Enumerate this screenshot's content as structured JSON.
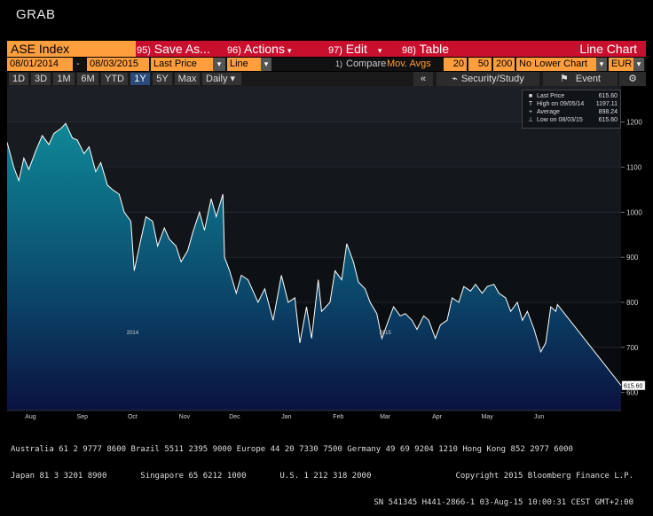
{
  "window": {
    "title": "GRAB"
  },
  "toolbar": {
    "ticker": "ASE Index",
    "menus": [
      {
        "num": "95)",
        "label": "Save As...",
        "arrow": ""
      },
      {
        "num": "96)",
        "label": "Actions",
        "arrow": "▾"
      },
      {
        "num": "97)",
        "label": "Edit",
        "arrow": "▾"
      },
      {
        "num": "98)",
        "label": "Table",
        "arrow": ""
      }
    ],
    "chart_type_title": "Line Chart"
  },
  "controls": {
    "start_date": "08/01/2014",
    "dash": "-",
    "end_date": "08/03/2015",
    "field": "Last Price",
    "style": "Line",
    "compare_num": "1)",
    "compare_label": "Compare",
    "compare_value": "Mov. Avgs",
    "ma1": "20",
    "ma2": "50",
    "ma3": "200",
    "lower_chart": "No Lower Chart",
    "currency": "EUR",
    "dd_arrow": "▾"
  },
  "timeframes": [
    "1D",
    "3D",
    "1M",
    "6M",
    "YTD",
    "1Y",
    "5Y",
    "Max"
  ],
  "selected_timeframe": "1Y",
  "periodicity": "Daily",
  "tools": {
    "collapse": "«",
    "security_study": "Security/Study",
    "event": "Event"
  },
  "legend": {
    "items": [
      {
        "mark": "■",
        "label": "Last Price",
        "value": "615.60"
      },
      {
        "mark": "T",
        "label": "High on 09/05/14",
        "value": "1197.11"
      },
      {
        "mark": "+",
        "label": "Average",
        "value": "898.24"
      },
      {
        "mark": "⊥",
        "label": "Low on 08/03/15",
        "value": "615.60"
      }
    ]
  },
  "footer": {
    "line1": "Australia 61 2 9777 8600 Brazil 5511 2395 9000 Europe 44 20 7330 7500 Germany 49 69 9204 1210 Hong Kong 852 2977 6000",
    "line2a": "Japan 81 3 3201 8900       Singapore 65 6212 1000       U.S. 1 212 318 2000",
    "line2b": "Copyright 2015 Bloomberg Finance L.P.",
    "line3": "SN 541345 H441-2866-1 03-Aug-15 10:00:31 CEST GMT+2:00"
  },
  "colors": {
    "accent_red": "#c8102e",
    "accent_orange": "#ff9e3d",
    "line": "#ffffff",
    "fill_top": "#0e7f8f",
    "fill_bottom": "#0b1240"
  },
  "chart_data": {
    "type": "area",
    "title": "",
    "xlabel": "",
    "ylabel": "",
    "ylim": [
      560,
      1280
    ],
    "yticks": [
      600,
      700,
      800,
      900,
      1000,
      1100,
      1200
    ],
    "xlim": [
      "2014-08-01",
      "2015-08-03"
    ],
    "month_ticks": [
      {
        "date": "2014-08-15",
        "label": "Aug",
        "year": ""
      },
      {
        "date": "2014-09-15",
        "label": "Sep",
        "year": ""
      },
      {
        "date": "2014-10-15",
        "label": "Oct",
        "year": "2014"
      },
      {
        "date": "2014-11-15",
        "label": "Nov",
        "year": ""
      },
      {
        "date": "2014-12-15",
        "label": "Dec",
        "year": ""
      },
      {
        "date": "2015-01-15",
        "label": "Jan",
        "year": ""
      },
      {
        "date": "2015-02-15",
        "label": "Feb",
        "year": ""
      },
      {
        "date": "2015-03-15",
        "label": "Mar",
        "year": "2015"
      },
      {
        "date": "2015-04-15",
        "label": "Apr",
        "year": ""
      },
      {
        "date": "2015-05-15",
        "label": "May",
        "year": ""
      },
      {
        "date": "2015-06-15",
        "label": "Jun",
        "year": ""
      }
    ],
    "last_label": "615.60",
    "series": [
      {
        "name": "Last Price",
        "points": [
          [
            "2014-08-01",
            1155
          ],
          [
            "2014-08-05",
            1100
          ],
          [
            "2014-08-08",
            1070
          ],
          [
            "2014-08-11",
            1120
          ],
          [
            "2014-08-14",
            1095
          ],
          [
            "2014-08-18",
            1135
          ],
          [
            "2014-08-22",
            1170
          ],
          [
            "2014-08-26",
            1150
          ],
          [
            "2014-08-29",
            1175
          ],
          [
            "2014-09-02",
            1185
          ],
          [
            "2014-09-05",
            1197
          ],
          [
            "2014-09-09",
            1165
          ],
          [
            "2014-09-12",
            1160
          ],
          [
            "2014-09-16",
            1130
          ],
          [
            "2014-09-19",
            1145
          ],
          [
            "2014-09-23",
            1090
          ],
          [
            "2014-09-26",
            1110
          ],
          [
            "2014-09-30",
            1060
          ],
          [
            "2014-10-03",
            1050
          ],
          [
            "2014-10-07",
            1040
          ],
          [
            "2014-10-10",
            1000
          ],
          [
            "2014-10-14",
            980
          ],
          [
            "2014-10-16",
            870
          ],
          [
            "2014-10-20",
            940
          ],
          [
            "2014-10-23",
            990
          ],
          [
            "2014-10-27",
            980
          ],
          [
            "2014-10-30",
            925
          ],
          [
            "2014-11-03",
            965
          ],
          [
            "2014-11-06",
            940
          ],
          [
            "2014-11-10",
            925
          ],
          [
            "2014-11-13",
            890
          ],
          [
            "2014-11-17",
            915
          ],
          [
            "2014-11-20",
            955
          ],
          [
            "2014-11-24",
            1000
          ],
          [
            "2014-11-27",
            960
          ],
          [
            "2014-12-01",
            1030
          ],
          [
            "2014-12-04",
            990
          ],
          [
            "2014-12-08",
            1040
          ],
          [
            "2014-12-09",
            900
          ],
          [
            "2014-12-12",
            870
          ],
          [
            "2014-12-16",
            820
          ],
          [
            "2014-12-19",
            860
          ],
          [
            "2014-12-23",
            850
          ],
          [
            "2014-12-29",
            800
          ],
          [
            "2015-01-02",
            830
          ],
          [
            "2015-01-07",
            760
          ],
          [
            "2015-01-12",
            860
          ],
          [
            "2015-01-16",
            800
          ],
          [
            "2015-01-20",
            810
          ],
          [
            "2015-01-23",
            710
          ],
          [
            "2015-01-27",
            790
          ],
          [
            "2015-01-30",
            720
          ],
          [
            "2015-02-03",
            850
          ],
          [
            "2015-02-05",
            780
          ],
          [
            "2015-02-10",
            800
          ],
          [
            "2015-02-13",
            870
          ],
          [
            "2015-02-17",
            850
          ],
          [
            "2015-02-20",
            930
          ],
          [
            "2015-02-24",
            890
          ],
          [
            "2015-02-27",
            845
          ],
          [
            "2015-03-03",
            830
          ],
          [
            "2015-03-06",
            800
          ],
          [
            "2015-03-10",
            775
          ],
          [
            "2015-03-13",
            720
          ],
          [
            "2015-03-17",
            760
          ],
          [
            "2015-03-20",
            790
          ],
          [
            "2015-03-24",
            770
          ],
          [
            "2015-03-27",
            775
          ],
          [
            "2015-03-31",
            760
          ],
          [
            "2015-04-03",
            740
          ],
          [
            "2015-04-07",
            770
          ],
          [
            "2015-04-10",
            760
          ],
          [
            "2015-04-14",
            720
          ],
          [
            "2015-04-17",
            750
          ],
          [
            "2015-04-21",
            760
          ],
          [
            "2015-04-24",
            810
          ],
          [
            "2015-04-28",
            800
          ],
          [
            "2015-05-01",
            835
          ],
          [
            "2015-05-05",
            825
          ],
          [
            "2015-05-08",
            840
          ],
          [
            "2015-05-12",
            820
          ],
          [
            "2015-05-15",
            835
          ],
          [
            "2015-05-19",
            840
          ],
          [
            "2015-05-22",
            820
          ],
          [
            "2015-05-26",
            810
          ],
          [
            "2015-05-29",
            780
          ],
          [
            "2015-06-02",
            800
          ],
          [
            "2015-06-05",
            760
          ],
          [
            "2015-06-08",
            780
          ],
          [
            "2015-06-12",
            740
          ],
          [
            "2015-06-16",
            690
          ],
          [
            "2015-06-19",
            710
          ],
          [
            "2015-06-22",
            790
          ],
          [
            "2015-06-25",
            780
          ],
          [
            "2015-06-26",
            795
          ],
          [
            "2015-08-03",
            615.6
          ]
        ]
      }
    ]
  }
}
